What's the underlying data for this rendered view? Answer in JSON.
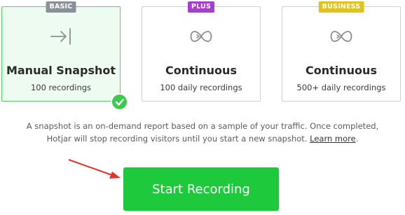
{
  "plans": [
    {
      "badge": "BASIC",
      "badge_color": "#8a8f98",
      "icon": "arrow-to-line-icon",
      "title": "Manual Snapshot",
      "subtitle": "100 recordings",
      "selected": true
    },
    {
      "badge": "PLUS",
      "badge_color": "#a93dd0",
      "icon": "infinity-icon",
      "title": "Continuous",
      "subtitle": "100 daily recordings",
      "selected": false
    },
    {
      "badge": "BUSINESS",
      "badge_color": "#e3c21a",
      "icon": "infinity-icon",
      "title": "Continuous",
      "subtitle": "500+ daily recordings",
      "selected": false
    }
  ],
  "description": {
    "line1": "A snapshot is an on-demand report based on a sample of your traffic. Once completed,",
    "line2_prefix": "Hotjar will stop recording visitors until you start a new snapshot. ",
    "link": "Learn more",
    "line2_suffix": "."
  },
  "start_button": "Start Recording",
  "colors": {
    "accent_green": "#1ec93c",
    "selected_border": "#4fd35e",
    "annotation_arrow": "#e8312a"
  }
}
